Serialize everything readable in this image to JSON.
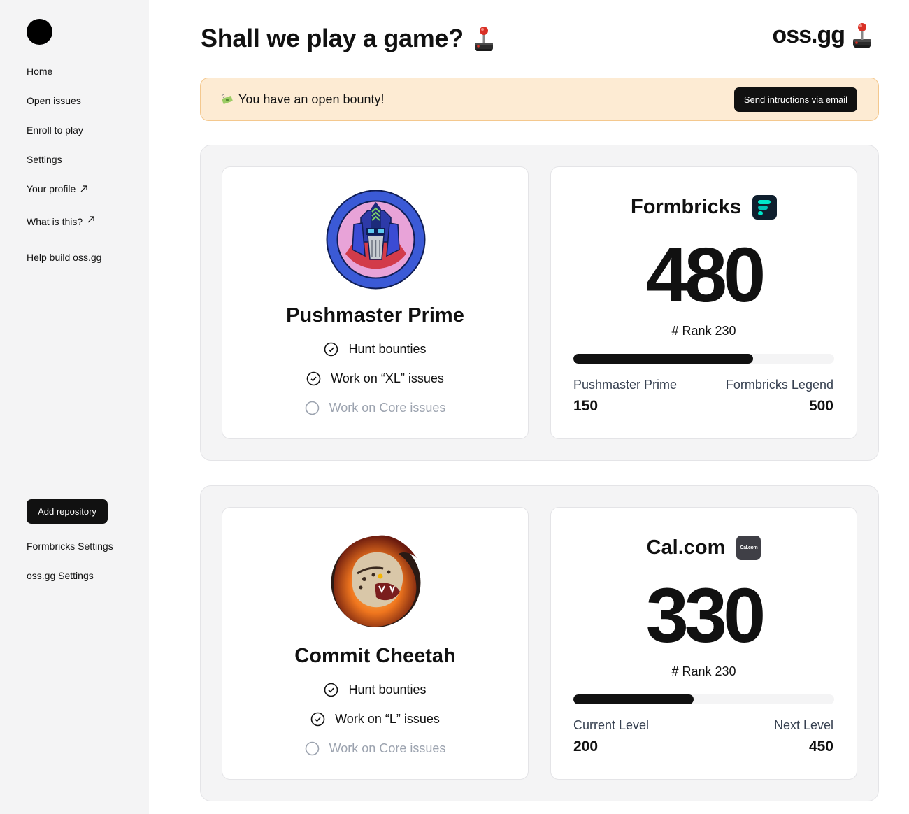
{
  "sidebar": {
    "items": [
      {
        "label": "Home",
        "external": false
      },
      {
        "label": "Open issues",
        "external": false
      },
      {
        "label": "Enroll to play",
        "external": false
      },
      {
        "label": "Settings",
        "external": false
      },
      {
        "label": "Your profile",
        "external": true
      },
      {
        "label": "What is this?",
        "external": true
      },
      {
        "label": "Help build oss.gg",
        "external": false
      }
    ],
    "add_repo_label": "Add repository",
    "bottom_items": [
      {
        "label": "Formbricks Settings"
      },
      {
        "label": "oss.gg Settings"
      }
    ]
  },
  "header": {
    "title": "Shall we play a game?",
    "brand": "oss.gg",
    "icon": "joystick-icon"
  },
  "banner": {
    "icon": "money-icon",
    "text": "You have an open bounty!",
    "button_label": "Send intructions via email"
  },
  "colors": {
    "banner_bg": "#fdebd3",
    "banner_border": "#f4c88e",
    "accent": "#111111",
    "sidebar_bg": "#f4f4f5"
  },
  "sections": [
    {
      "player": {
        "name": "Pushmaster Prime",
        "avatar": "robot-avatar",
        "skills": [
          {
            "label": "Hunt bounties",
            "done": true
          },
          {
            "label": "Work on “XL” issues",
            "done": true
          },
          {
            "label": "Work on Core issues",
            "done": false
          }
        ]
      },
      "repo": {
        "name": "Formbricks",
        "logo": "formbricks-logo-icon",
        "score": "480",
        "rank": "# Rank 230",
        "progress": 0.69,
        "left_label": "Pushmaster Prime",
        "left_value": "150",
        "right_label": "Formbricks Legend",
        "right_value": "500"
      }
    },
    {
      "player": {
        "name": "Commit Cheetah",
        "avatar": "cheetah-avatar",
        "skills": [
          {
            "label": "Hunt bounties",
            "done": true
          },
          {
            "label": "Work on “L” issues",
            "done": true
          },
          {
            "label": "Work on Core issues",
            "done": false
          }
        ]
      },
      "repo": {
        "name": "Cal.com",
        "logo": "calcom-logo-icon",
        "logo_text": "Cal.com",
        "score": "330",
        "rank": "# Rank 230",
        "progress": 0.46,
        "left_label": "Current Level",
        "left_value": "200",
        "right_label": "Next Level",
        "right_value": "450"
      }
    }
  ]
}
